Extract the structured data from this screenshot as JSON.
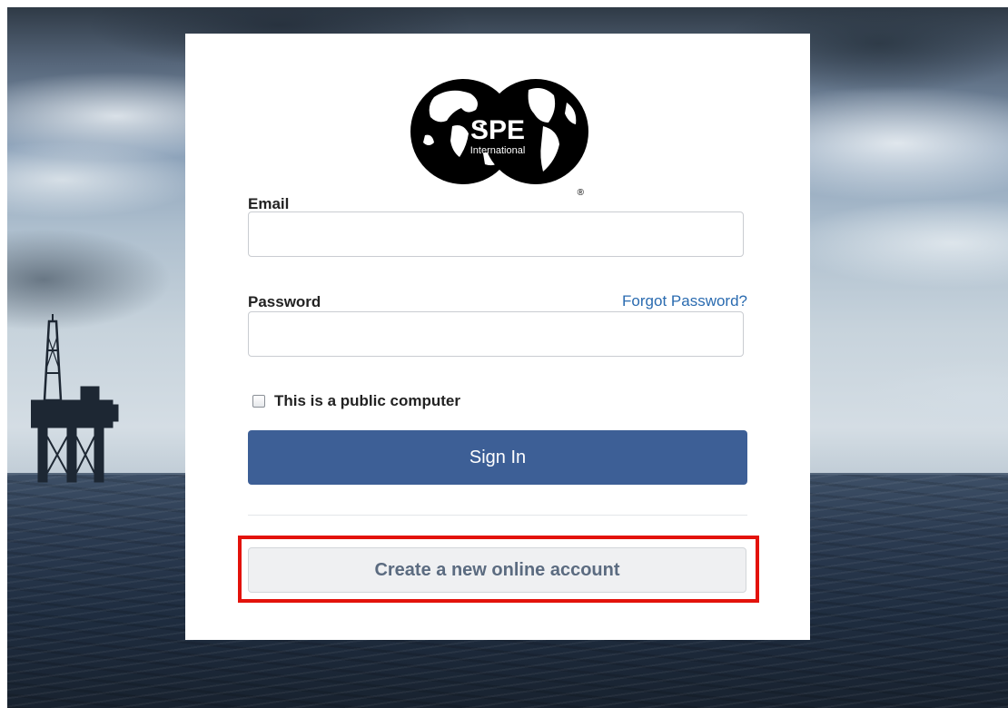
{
  "brand": {
    "logo_text": "SPE",
    "logo_subtext": "International",
    "registered_mark": "®"
  },
  "form": {
    "email_label": "Email",
    "email_value": "",
    "password_label": "Password",
    "password_value": "",
    "forgot_password": "Forgot Password?",
    "public_computer_label": "This is a public computer",
    "public_computer_checked": false,
    "sign_in": "Sign In",
    "create_account": "Create a new online account"
  },
  "colors": {
    "primary_button": "#3d5f96",
    "link": "#2a6bb0",
    "highlight_outline": "#e3120b"
  }
}
